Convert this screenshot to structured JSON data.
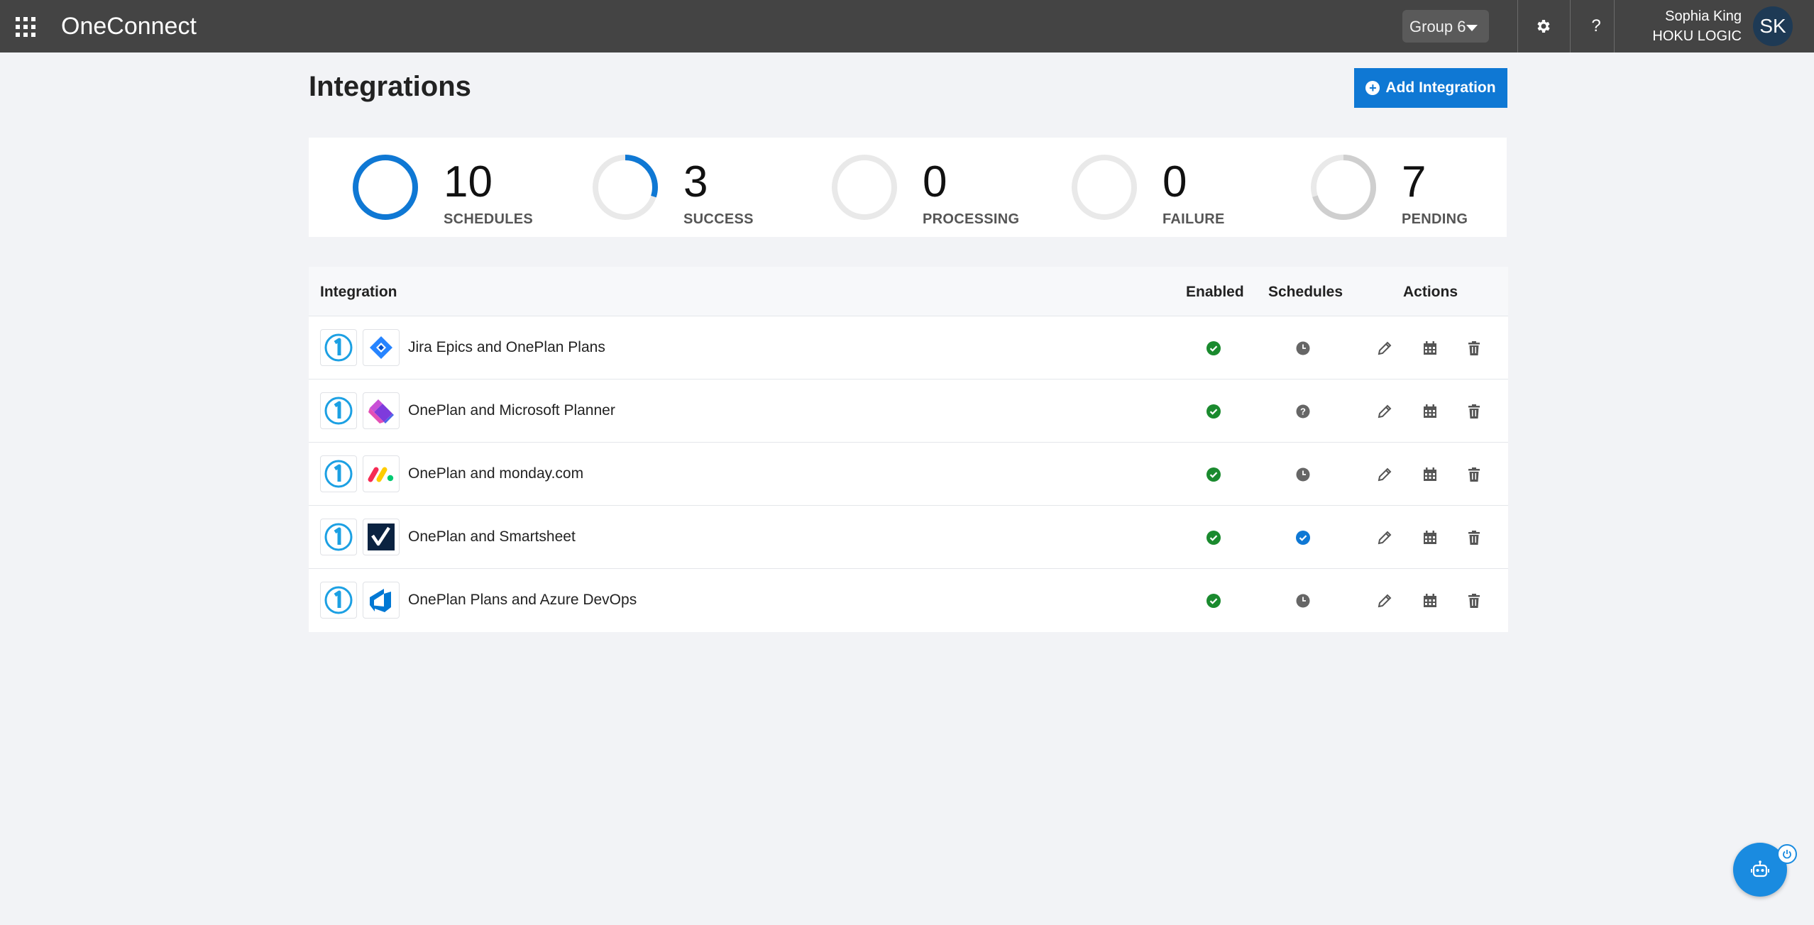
{
  "topbar": {
    "app_title": "OneConnect",
    "group_select": "Group 6",
    "settings_icon": "gear-icon",
    "help_label": "?",
    "user_name": "Sophia King",
    "user_org": "HOKU LOGIC",
    "avatar_initials": "SK"
  },
  "header": {
    "title": "Integrations",
    "add_button_label": "Add Integration"
  },
  "stats": [
    {
      "value": "10",
      "label": "SCHEDULES",
      "ring_fraction": 1.0,
      "ring_color": "#0f78d4"
    },
    {
      "value": "3",
      "label": "SUCCESS",
      "ring_fraction": 0.3,
      "ring_color": "#0f78d4"
    },
    {
      "value": "0",
      "label": "PROCESSING",
      "ring_fraction": 0,
      "ring_color": "#0f78d4"
    },
    {
      "value": "0",
      "label": "FAILURE",
      "ring_fraction": 0,
      "ring_color": "#0f78d4"
    },
    {
      "value": "7",
      "label": "PENDING",
      "ring_fraction": 0.7,
      "ring_color": "#cfcfcf"
    }
  ],
  "table": {
    "headers": {
      "integration": "Integration",
      "enabled": "Enabled",
      "schedules": "Schedules",
      "actions": "Actions"
    },
    "rows": [
      {
        "name": "Jira Epics and OnePlan Plans",
        "partner_logo": "jira-icon",
        "enabled": true,
        "schedule_status": "clock-icon"
      },
      {
        "name": "OnePlan and Microsoft Planner",
        "partner_logo": "microsoft-planner-icon",
        "enabled": true,
        "schedule_status": "question-icon"
      },
      {
        "name": "OnePlan and monday.com",
        "partner_logo": "monday-icon",
        "enabled": true,
        "schedule_status": "clock-icon"
      },
      {
        "name": "OnePlan and Smartsheet",
        "partner_logo": "smartsheet-icon",
        "enabled": true,
        "schedule_status": "check-blue-icon"
      },
      {
        "name": "OnePlan Plans and Azure DevOps",
        "partner_logo": "azure-devops-icon",
        "enabled": true,
        "schedule_status": "clock-icon"
      }
    ],
    "action_icons": [
      "edit-icon",
      "calendar-icon",
      "delete-icon"
    ]
  },
  "colors": {
    "topbar": "#444444",
    "accent": "#0f78d4",
    "enabled_green": "#1a8a2e",
    "background": "#f2f3f6"
  }
}
